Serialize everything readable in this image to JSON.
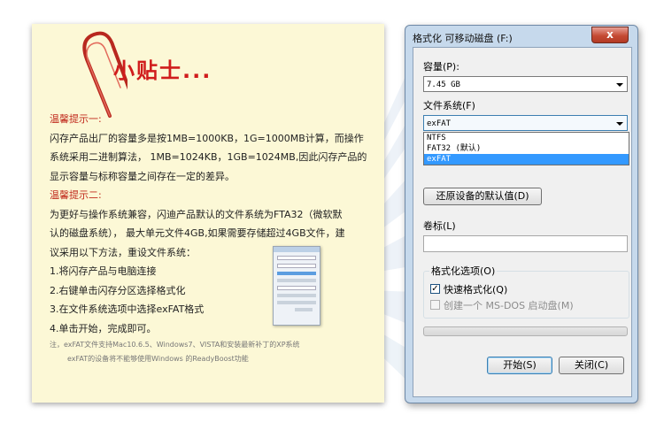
{
  "tips": {
    "title": "小贴士...",
    "tip1_heading": "温馨提示一:",
    "tip1_line1": "闪存产品出厂的容量多是按1MB=1000KB，1G=1000MB计算，而操作",
    "tip1_line2": "系统采用二进制算法， 1MB=1024KB，1GB=1024MB,因此闪存产品的",
    "tip1_line3": "显示容量与标称容量之间存在一定的差异。",
    "tip2_heading": "温馨提示二:",
    "tip2_line1": "为更好与操作系统兼容，闪迪产品默认的文件系统为FTA32（微软默",
    "tip2_line2": "认的磁盘系统）， 最大单元文件4GB,如果需要存储超过4GB文件，建",
    "tip2_line3": "议采用以下方法，重设文件系统：",
    "step1": "1.将闪存产品与电脑连接",
    "step2": "2.右键单击闪存分区选择格式化",
    "step3": "3.在文件系统选项中选择exFAT格式",
    "step4": "4.单击开始，完成即可。",
    "note1": "注，exFAT文件支持Mac10.6.5、Windows7、VISTA和安装最新补丁的XP系统",
    "note2": "exFAT的设备将不能够使用Windows 的ReadyBoost功能"
  },
  "dialog": {
    "title": "格式化 可移动磁盘 (F:)",
    "close_label": "x",
    "capacity_label": "容量(P):",
    "capacity_value": "7.45 GB",
    "filesystem_label": "文件系统(F)",
    "filesystem_value": "exFAT",
    "filesystem_options": [
      "NTFS",
      "FAT32 (默认)",
      "exFAT"
    ],
    "restore_defaults_label": "还原设备的默认值(D)",
    "volume_label": "卷标(L)",
    "volume_value": "",
    "format_options_label": "格式化选项(O)",
    "quick_format_label": "快速格式化(Q)",
    "quick_format_checked": true,
    "msdos_label": "创建一个 MS-DOS 启动盘(M)",
    "msdos_checked": false,
    "start_label": "开始(S)",
    "close_button_label": "关闭(C)"
  },
  "colors": {
    "title_red": "#d01c1c",
    "heading_red": "#c0281b",
    "card_bg": "#fcf8d6",
    "selection_blue": "#3399ff"
  }
}
